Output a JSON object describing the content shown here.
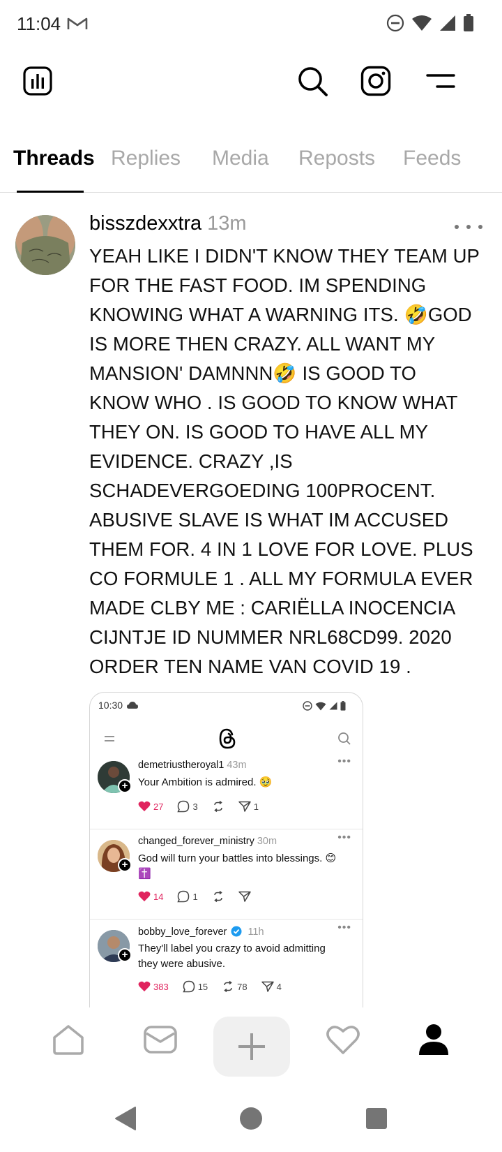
{
  "status_bar": {
    "time": "11:04",
    "icons": [
      "gmail-icon",
      "do-not-disturb-icon",
      "wifi-icon",
      "cellular-signal-icon",
      "battery-icon"
    ]
  },
  "header": {
    "icons": [
      "insights-icon",
      "search-icon",
      "instagram-icon",
      "menu-icon"
    ]
  },
  "tabs": [
    {
      "label": "Threads",
      "active": true
    },
    {
      "label": "Replies",
      "active": false
    },
    {
      "label": "Media",
      "active": false
    },
    {
      "label": "Reposts",
      "active": false
    },
    {
      "label": "Feeds",
      "active": false
    }
  ],
  "post": {
    "username": "bisszdexxtra",
    "time": "13m",
    "text_lines": [
      "YEAH LIKE I DIDN'T KNOW THEY TEAM UP",
      "FOR THE FAST FOOD. IM SPENDING",
      "KNOWING WHAT A WARNING ITS. 🤣GOD",
      "IS  MORE THEN CRAZY. ALL WANT MY",
      "MANSION' DAMNNN🤣 IS GOOD TO",
      "KNOW WHO . IS GOOD TO KNOW WHAT",
      "THEY ON. IS GOOD TO HAVE ALL MY",
      "EVIDENCE. CRAZY ,IS",
      "SCHADEVERGOEDING 100PROCENT.",
      "ABUSIVE SLAVE IS WHAT IM ACCUSED",
      "THEM FOR. 4 IN 1 LOVE FOR LOVE. PLUS",
      "CO FORMULE 1 . ALL MY FORMULA EVER",
      "MADE CLBY ME : CARIËLLA INOCENCIA",
      "CIJNTJE ID NUMMER NRL68CD99. 2020",
      "ORDER TEN NAME VAN COVID 19 ."
    ]
  },
  "embedded_screenshot": {
    "time": "10:30",
    "posts": [
      {
        "username": "demetriustheroyal1",
        "time": "43m",
        "verified": false,
        "text": "Your Ambition is admired. 🥹",
        "likes": "27",
        "replies": "3",
        "reposts": "",
        "shares": "1"
      },
      {
        "username": "changed_forever_ministry",
        "time": "30m",
        "verified": false,
        "text": "God will turn your battles into blessings. 😊✝️",
        "likes": "14",
        "replies": "1",
        "reposts": "",
        "shares": ""
      },
      {
        "username": "bobby_love_forever",
        "time": "11h",
        "verified": true,
        "text": "They'll label you crazy to avoid admitting they were abusive.",
        "likes": "383",
        "replies": "15",
        "reposts": "78",
        "shares": "4"
      }
    ]
  },
  "bottom_nav": [
    "home-icon",
    "messages-icon",
    "create-icon",
    "activity-icon",
    "profile-icon"
  ],
  "system_nav": [
    "back-icon",
    "home-circle-icon",
    "recents-icon"
  ],
  "colors": {
    "like": "#e0245e",
    "verified": "#1d9bf0",
    "inactive_tab": "#a8a8a8"
  }
}
